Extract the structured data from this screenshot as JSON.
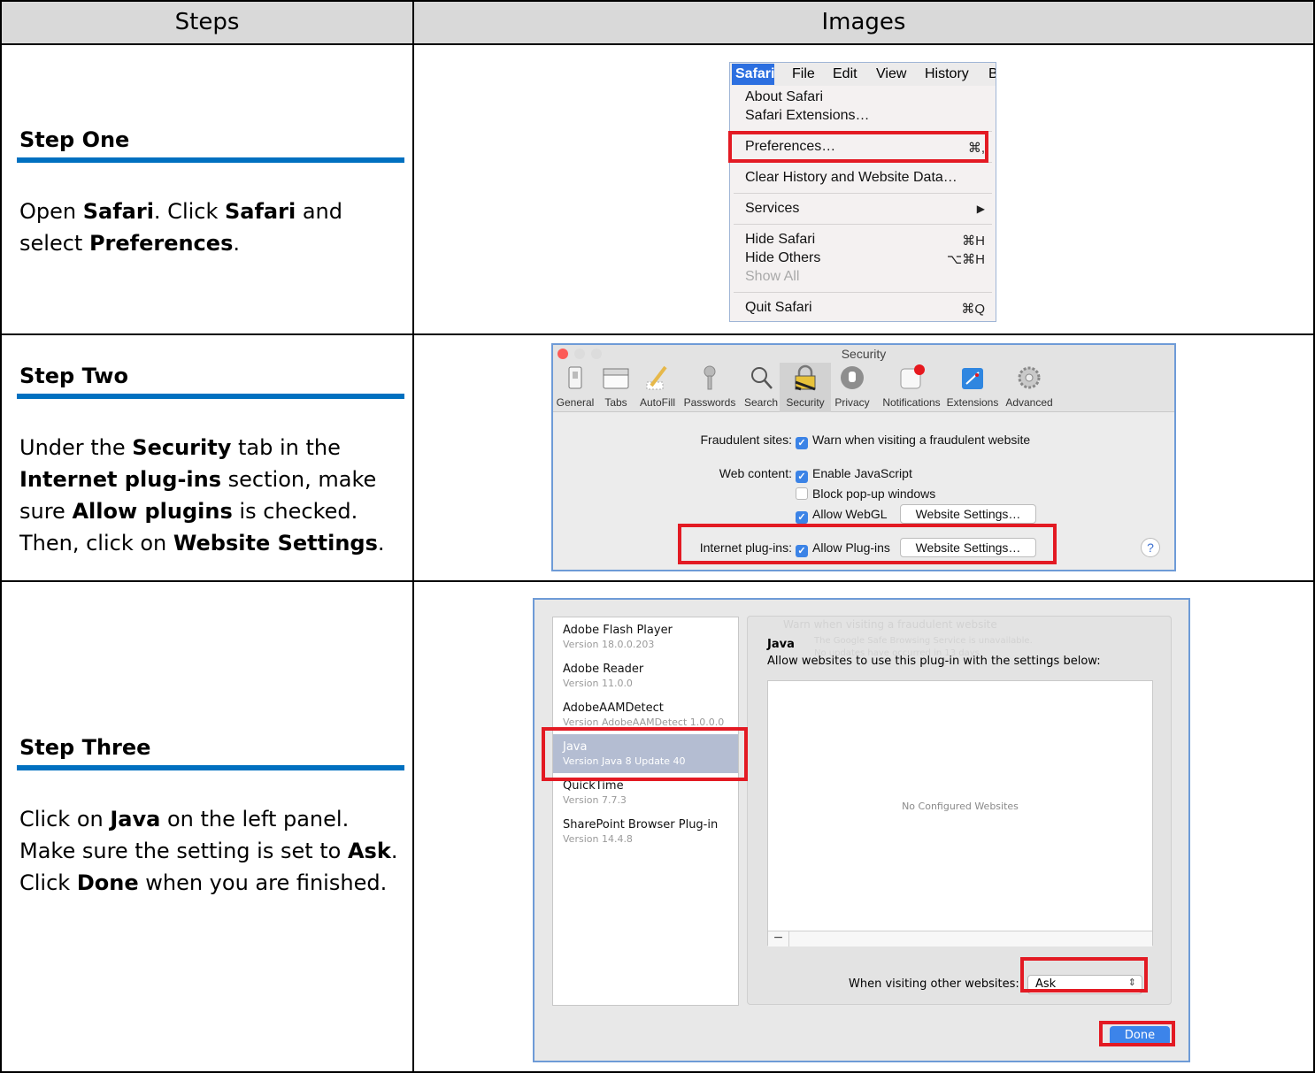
{
  "table": {
    "col_steps": "Steps",
    "col_images": "Images"
  },
  "step1": {
    "title": "Step One",
    "parts": [
      "Open ",
      "Safari",
      ". Click ",
      "Safari",
      " and select ",
      "Preferences",
      "."
    ]
  },
  "step2": {
    "title": "Step Two",
    "parts": [
      "Under the ",
      "Security",
      " tab in the ",
      "Internet plug-ins",
      " section, make sure ",
      "Allow plugins",
      " is checked. Then, click on ",
      "Website Settings",
      "."
    ]
  },
  "step3": {
    "title": "Step Three",
    "parts": [
      "Click on ",
      "Java",
      " on the left panel. Make sure the setting is set to ",
      "Ask",
      ". Click ",
      "Done",
      " when you are finished."
    ]
  },
  "safari_menu": {
    "menubar": [
      "Safari",
      "File",
      "Edit",
      "View",
      "History",
      "B"
    ],
    "items": {
      "about": "About Safari",
      "extensions": "Safari Extensions…",
      "preferences": "Preferences…",
      "preferences_shortcut": "⌘,",
      "clear_history": "Clear History and Website Data…",
      "services": "Services",
      "services_arrow": "▶",
      "hide_safari": "Hide Safari",
      "hide_safari_shortcut": "⌘H",
      "hide_others": "Hide Others",
      "hide_others_shortcut": "⌥⌘H",
      "show_all": "Show All",
      "quit": "Quit Safari",
      "quit_shortcut": "⌘Q"
    }
  },
  "security_prefs": {
    "window_title": "Security",
    "toolbar": [
      "General",
      "Tabs",
      "AutoFill",
      "Passwords",
      "Search",
      "Security",
      "Privacy",
      "Notifications",
      "Extensions",
      "Advanced"
    ],
    "fraudulent_label": "Fraudulent sites:",
    "fraudulent_option": "Warn when visiting a fraudulent website",
    "web_content_label": "Web content:",
    "enable_js": "Enable JavaScript",
    "block_popups": "Block pop-up windows",
    "allow_webgl": "Allow WebGL",
    "website_settings": "Website Settings…",
    "plugins_label": "Internet plug-ins:",
    "allow_plugins": "Allow Plug-ins",
    "help": "?"
  },
  "plugins": {
    "list": [
      {
        "name": "Adobe Flash Player",
        "version": "Version 18.0.0.203"
      },
      {
        "name": "Adobe Reader",
        "version": "Version 11.0.0"
      },
      {
        "name": "AdobeAAMDetect",
        "version": "Version AdobeAAMDetect 1.0.0.0"
      },
      {
        "name": "Java",
        "version": "Version Java 8 Update 40"
      },
      {
        "name": "QuickTime",
        "version": "Version 7.7.3"
      },
      {
        "name": "SharePoint Browser Plug-in",
        "version": "Version 14.4.8"
      }
    ],
    "selected_title": "Java",
    "description": "Allow websites to use this plug-in with the settings below:",
    "empty_text": "No Configured Websites",
    "minus": "−",
    "when_visiting_label": "When visiting other websites:",
    "when_visiting_value": "Ask",
    "select_arrows": "⇕",
    "done": "Done",
    "ghost_lines": [
      "Warn when visiting a fraudulent website",
      "The Google Safe Browsing Service is unavailable.",
      "No updates have occurred in 13 days."
    ]
  }
}
